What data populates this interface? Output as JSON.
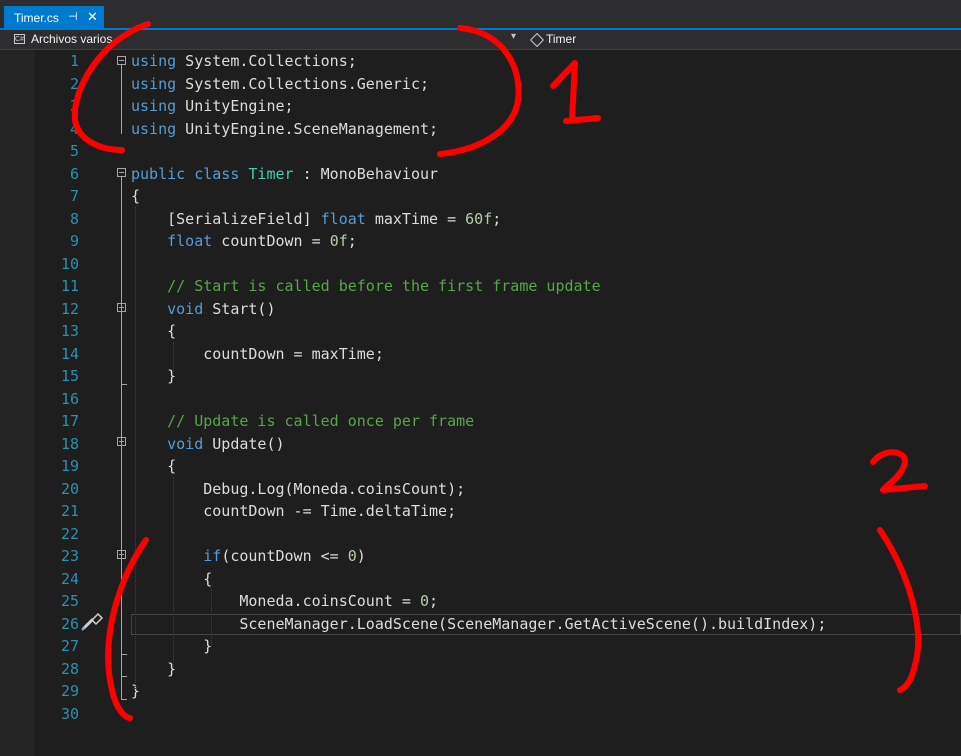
{
  "tab": {
    "title": "Timer.cs",
    "pin_glyph": "⊣",
    "close_glyph": "✕"
  },
  "nav": {
    "project_icon_text": "C#",
    "project": "Archivos varios",
    "chevron": "▾",
    "class_member": "Timer"
  },
  "lines": [
    {
      "n": "1",
      "tokens": [
        {
          "t": "using",
          "c": "kw"
        },
        {
          "t": " System.Collections;"
        }
      ]
    },
    {
      "n": "2",
      "tokens": [
        {
          "t": "using",
          "c": "kw"
        },
        {
          "t": " System.Collections.Generic;"
        }
      ]
    },
    {
      "n": "3",
      "tokens": [
        {
          "t": "using",
          "c": "kw"
        },
        {
          "t": " UnityEngine;"
        }
      ]
    },
    {
      "n": "4",
      "tokens": [
        {
          "t": "using",
          "c": "kw"
        },
        {
          "t": " UnityEngine.SceneManagement;"
        }
      ]
    },
    {
      "n": "5",
      "tokens": []
    },
    {
      "n": "6",
      "tokens": [
        {
          "t": "public",
          "c": "kw"
        },
        {
          "t": " "
        },
        {
          "t": "class",
          "c": "kw"
        },
        {
          "t": " "
        },
        {
          "t": "Timer",
          "c": "ty"
        },
        {
          "t": " : MonoBehaviour"
        }
      ]
    },
    {
      "n": "7",
      "tokens": [
        {
          "t": "{"
        }
      ]
    },
    {
      "n": "8",
      "tokens": [
        {
          "t": "    [SerializeField] "
        },
        {
          "t": "float",
          "c": "kw"
        },
        {
          "t": " maxTime = "
        },
        {
          "t": "60f",
          "c": "nm"
        },
        {
          "t": ";"
        }
      ]
    },
    {
      "n": "9",
      "tokens": [
        {
          "t": "    "
        },
        {
          "t": "float",
          "c": "kw"
        },
        {
          "t": " countDown = "
        },
        {
          "t": "0f",
          "c": "nm"
        },
        {
          "t": ";"
        }
      ]
    },
    {
      "n": "10",
      "tokens": []
    },
    {
      "n": "11",
      "tokens": [
        {
          "t": "    "
        },
        {
          "t": "// Start is called before the first frame update",
          "c": "cm"
        }
      ]
    },
    {
      "n": "12",
      "tokens": [
        {
          "t": "    "
        },
        {
          "t": "void",
          "c": "kw"
        },
        {
          "t": " Start()"
        }
      ]
    },
    {
      "n": "13",
      "tokens": [
        {
          "t": "    {"
        }
      ]
    },
    {
      "n": "14",
      "tokens": [
        {
          "t": "        countDown = maxTime;"
        }
      ]
    },
    {
      "n": "15",
      "tokens": [
        {
          "t": "    }"
        }
      ]
    },
    {
      "n": "16",
      "tokens": []
    },
    {
      "n": "17",
      "tokens": [
        {
          "t": "    "
        },
        {
          "t": "// Update is called once per frame",
          "c": "cm"
        }
      ]
    },
    {
      "n": "18",
      "tokens": [
        {
          "t": "    "
        },
        {
          "t": "void",
          "c": "kw"
        },
        {
          "t": " Update()"
        }
      ]
    },
    {
      "n": "19",
      "tokens": [
        {
          "t": "    {"
        }
      ]
    },
    {
      "n": "20",
      "tokens": [
        {
          "t": "        Debug.Log(Moneda.coinsCount);"
        }
      ]
    },
    {
      "n": "21",
      "tokens": [
        {
          "t": "        countDown -= Time.deltaTime;"
        }
      ]
    },
    {
      "n": "22",
      "tokens": []
    },
    {
      "n": "23",
      "tokens": [
        {
          "t": "        "
        },
        {
          "t": "if",
          "c": "kw"
        },
        {
          "t": "(countDown <= "
        },
        {
          "t": "0",
          "c": "nm"
        },
        {
          "t": ")"
        }
      ]
    },
    {
      "n": "24",
      "tokens": [
        {
          "t": "        {"
        }
      ]
    },
    {
      "n": "25",
      "tokens": [
        {
          "t": "            Moneda.coinsCount = "
        },
        {
          "t": "0",
          "c": "nm"
        },
        {
          "t": ";"
        }
      ]
    },
    {
      "n": "26",
      "tokens": [
        {
          "t": "            SceneManager.LoadScene(SceneManager.GetActiveScene().buildIndex);"
        }
      ]
    },
    {
      "n": "27",
      "tokens": [
        {
          "t": "        }"
        }
      ]
    },
    {
      "n": "28",
      "tokens": [
        {
          "t": "    }"
        }
      ]
    },
    {
      "n": "29",
      "tokens": [
        {
          "t": "}"
        }
      ]
    },
    {
      "n": "30",
      "tokens": []
    }
  ],
  "annotations": {
    "label_1": "1",
    "label_2": "2",
    "color": "#ff0000"
  },
  "theme": {
    "keyword": "#569cd6",
    "type": "#4ec9b0",
    "comment": "#57a64a",
    "number": "#b5cea8",
    "line_number": "#2b91af",
    "accent": "#007acc"
  }
}
